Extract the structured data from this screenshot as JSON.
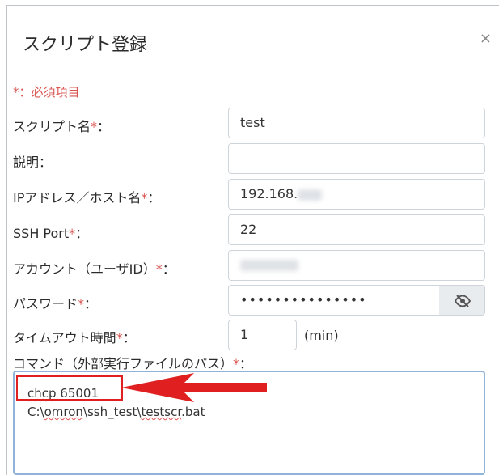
{
  "dialog": {
    "title": "スクリプト登録",
    "close_label": "×"
  },
  "form": {
    "required_note": "*：必須項目",
    "fields": {
      "script_name": {
        "label": "スクリプト名",
        "star": "*",
        "colon": "：",
        "value": "test"
      },
      "description": {
        "label": "説明：",
        "value": ""
      },
      "ip_host": {
        "label": "IPアドレス／ホスト名",
        "star": "*",
        "colon": "：",
        "value": "192.168."
      },
      "ssh_port": {
        "label": "SSH Port",
        "star": "*",
        "colon": "：",
        "value": "22"
      },
      "account": {
        "label": "アカウント（ユーザID）",
        "star": "*",
        "colon": "：",
        "value": ""
      },
      "password": {
        "label": "パスワード",
        "star": "*",
        "colon": "：",
        "value": "•••••••••••••••"
      },
      "timeout": {
        "label": "タイムアウト時間",
        "star": "*",
        "colon": "：",
        "value": "1",
        "unit": "(min)"
      },
      "command": {
        "label": "コマンド（外部実行ファイルのパス）",
        "star": "*",
        "colon": "：",
        "lines": {
          "line1_a": "chcp",
          "line1_b": " 65001",
          "line2_a": "C:\\",
          "line2_b": "omron",
          "line2_c": "\\ssh_test\\",
          "line2_d": "testscr",
          "line2_e": ".bat"
        }
      }
    }
  },
  "icons": {
    "eye_toggle": "eye-slash-icon",
    "annotation_arrow": "arrow-left-icon"
  },
  "colors": {
    "required": "#d9534f",
    "annotation": "#e02020",
    "focus_border": "#8fb3d9"
  }
}
